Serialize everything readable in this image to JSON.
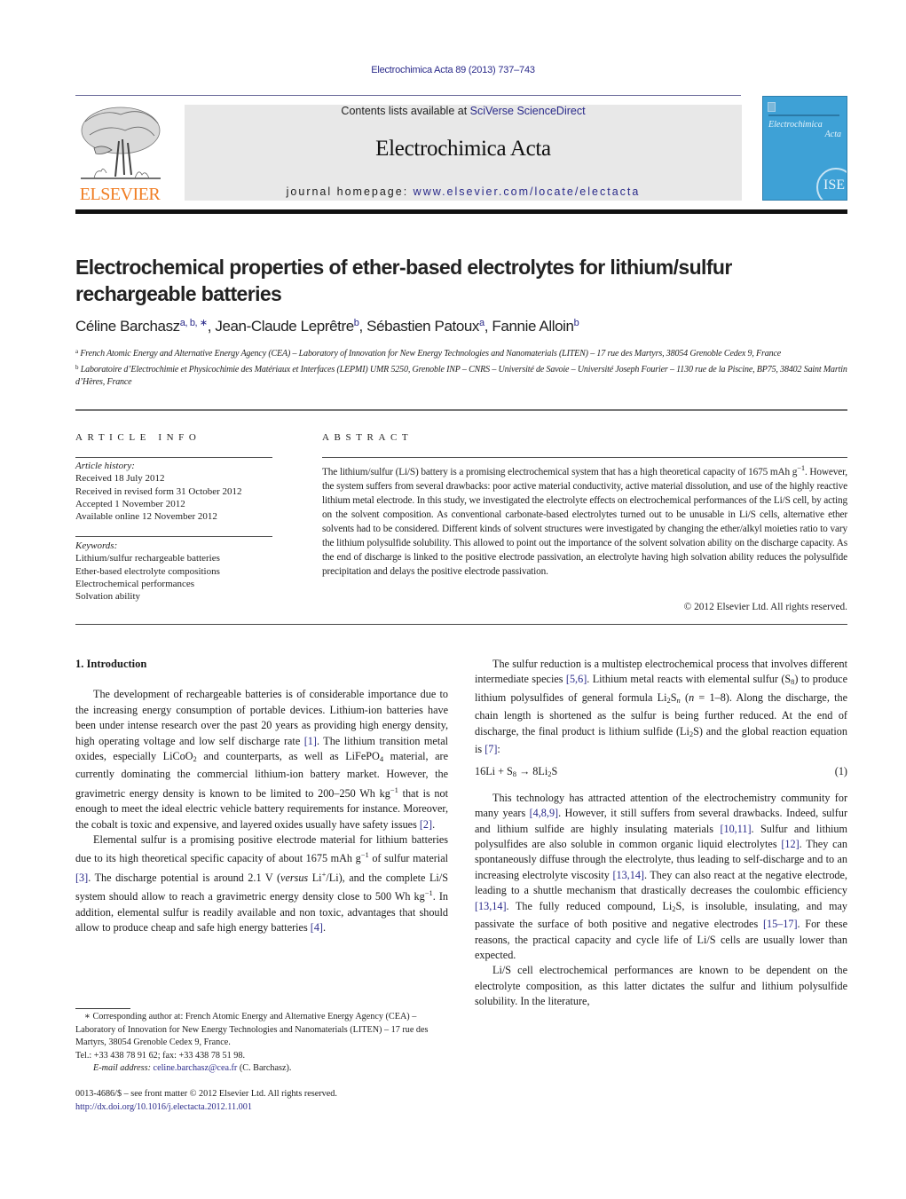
{
  "citation": "Electrochimica Acta 89 (2013) 737–743",
  "header": {
    "publisher_logo_text": "ELSEVIER",
    "contents_prefix": "Contents lists available at ",
    "contents_link": "SciVerse ScienceDirect",
    "journal_name": "Electrochimica Acta",
    "homepage_prefix": "journal homepage: ",
    "homepage_link": "www.elsevier.com/locate/electacta",
    "cover_title_line1": "Electrochimica",
    "cover_title_line2": "Acta",
    "cover_badge": "ISE",
    "colors": {
      "publisher_orange": "#f07d23",
      "cover_blue": "#3ea1d6",
      "link_blue": "#2a2a8a",
      "banner_gray": "#e8e8e8"
    }
  },
  "article": {
    "title": "Electrochemical properties of ether-based electrolytes for lithium/sulfur rechargeable batteries",
    "authors": [
      {
        "name": "Céline Barchasz",
        "sup": "a, b, ∗"
      },
      {
        "name": "Jean-Claude Leprêtre",
        "sup": "b"
      },
      {
        "name": "Sébastien Patoux",
        "sup": "a"
      },
      {
        "name": "Fannie Alloin",
        "sup": "b"
      }
    ],
    "affiliations": [
      {
        "mark": "a",
        "text": "French Atomic Energy and Alternative Energy Agency (CEA) – Laboratory of Innovation for New Energy Technologies and Nanomaterials (LITEN) – 17 rue des Martyrs, 38054 Grenoble Cedex 9, France"
      },
      {
        "mark": "b",
        "text": "Laboratoire d’Electrochimie et Physicochimie des Matériaux et Interfaces (LEPMI) UMR 5250, Grenoble INP – CNRS – Université de Savoie – Université Joseph Fourier – 1130 rue de la Piscine, BP75, 38402 Saint Martin d’Hères, France"
      }
    ]
  },
  "article_info": {
    "heading": "ARTICLE INFO",
    "history_label": "Article history:",
    "history": [
      "Received 18 July 2012",
      "Received in revised form 31 October 2012",
      "Accepted 1 November 2012",
      "Available online 12 November 2012"
    ],
    "keywords_label": "Keywords:",
    "keywords": [
      "Lithium/sulfur rechargeable batteries",
      "Ether-based electrolyte compositions",
      "Electrochemical performances",
      "Solvation ability"
    ]
  },
  "abstract": {
    "heading": "ABSTRACT",
    "text_part1": "The lithium/sulfur (Li/S) battery is a promising electrochemical system that has a high theoretical capacity of 1675 mAh g",
    "text_sup1": "−1",
    "text_part2": ". However, the system suffers from several drawbacks: poor active material conductivity, active material dissolution, and use of the highly reactive lithium metal electrode. In this study, we investigated the electrolyte effects on electrochemical performances of the Li/S cell, by acting on the solvent composition. As conventional carbonate-based electrolytes turned out to be unusable in Li/S cells, alternative ether solvents had to be considered. Different kinds of solvent structures were investigated by changing the ether/alkyl moieties ratio to vary the lithium polysulfide solubility. This allowed to point out the importance of the solvent solvation ability on the discharge capacity. As the end of discharge is linked to the positive electrode passivation, an electrolyte having high solvation ability reduces the polysulfide precipitation and delays the positive electrode passivation.",
    "copyright": "© 2012 Elsevier Ltd. All rights reserved."
  },
  "body": {
    "section1_heading": "1.  Introduction",
    "p1": {
      "a": "The development of rechargeable batteries is of considerable importance due to the increasing energy consumption of portable devices. Lithium-ion batteries have been under intense research over the past 20 years as providing high energy density, high operating voltage and low self discharge rate ",
      "ref1": "[1]",
      "b": ". The lithium transition metal oxides, especially LiCoO",
      "sub1": "2",
      "c": " and counterparts, as well as LiFePO",
      "sub2": "4",
      "d": " material, are currently dominating the commercial lithium-ion battery market. However, the gravimetric energy density is known to be limited to 200–250 Wh kg",
      "sup1": "−1",
      "e": " that is not enough to meet the ideal electric vehicle battery requirements for instance. Moreover, the cobalt is toxic and expensive, and layered oxides usually have safety issues ",
      "ref2": "[2]",
      "f": "."
    },
    "p2": {
      "a": "Elemental sulfur is a promising positive electrode material for lithium batteries due to its high theoretical specific capacity of about 1675 mAh g",
      "sup1": "−1",
      "b": " of sulfur material ",
      "ref3": "[3]",
      "c": ". The discharge potential is around 2.1 V (",
      "italic": "versus",
      "d": " Li",
      "sup2": "+",
      "e": "/Li), and the complete Li/S system should allow to reach a gravimetric energy density close to 500 Wh kg",
      "sup3": "−1",
      "f": ". In addition, elemental sulfur is readily available and non toxic, advantages that should allow to produce cheap and safe high energy batteries ",
      "ref4": "[4]",
      "g": "."
    },
    "p3": {
      "a": "The sulfur reduction is a multistep electrochemical process that involves different intermediate species ",
      "ref1": "[5,6]",
      "b": ". Lithium metal reacts with elemental sulfur (S",
      "sub1": "8",
      "c": ") to produce lithium polysulfides of general formula Li",
      "sub2": "2",
      "d": "S",
      "sub3": "n",
      "e": " (",
      "italic_n": "n",
      "f": " = 1–8). Along the discharge, the chain length is shortened as the sulfur is being further reduced. At the end of discharge, the final product is lithium sulfide (Li",
      "sub4": "2",
      "g": "S) and the global reaction equation is ",
      "ref2": "[7]",
      "h": ":"
    },
    "equation": {
      "lhs_a": "16Li + S",
      "lhs_sub": "8",
      "arrow": " → ",
      "rhs_a": "8Li",
      "rhs_sub": "2",
      "rhs_b": "S",
      "number": "(1)"
    },
    "p4": {
      "a": "This technology has attracted attention of the electrochemistry community for many years ",
      "ref1": "[4,8,9]",
      "b": ". However, it still suffers from several drawbacks. Indeed, sulfur and lithium sulfide are highly insulating materials ",
      "ref2": "[10,11]",
      "c": ". Sulfur and lithium polysulfides are also soluble in common organic liquid electrolytes ",
      "ref3": "[12]",
      "d": ". They can spontaneously diffuse through the electrolyte, thus leading to self-discharge and to an increasing electrolyte viscosity ",
      "ref4": "[13,14]",
      "e": ". They can also react at the negative electrode, leading to a shuttle mechanism that drastically decreases the coulombic efficiency ",
      "ref5": "[13,14]",
      "f": ". The fully reduced compound, Li",
      "sub1": "2",
      "g": "S, is insoluble, insulating, and may passivate the surface of both positive and negative electrodes ",
      "ref6": "[15–17]",
      "h": ". For these reasons, the practical capacity and cycle life of Li/S cells are usually lower than expected."
    },
    "p5": "Li/S cell electrochemical performances are known to be dependent on the electrolyte composition, as this latter dictates the sulfur and lithium polysulfide solubility. In the literature,"
  },
  "footnote": {
    "corresponding": "∗ Corresponding author at: French Atomic Energy and Alternative Energy Agency (CEA) – Laboratory of Innovation for New Energy Technologies and Nanomaterials (LITEN) – 17 rue des Martyrs, 38054 Grenoble Cedex 9, France.",
    "tel": "Tel.: +33 438 78 91 62; fax: +33 438 78 51 98.",
    "email_label": "E-mail address: ",
    "email": "celine.barchasz@cea.fr",
    "email_suffix": " (C. Barchasz).",
    "issn": "0013-4686/$ – see front matter © 2012 Elsevier Ltd. All rights reserved.",
    "doi": "http://dx.doi.org/10.1016/j.electacta.2012.11.001"
  }
}
